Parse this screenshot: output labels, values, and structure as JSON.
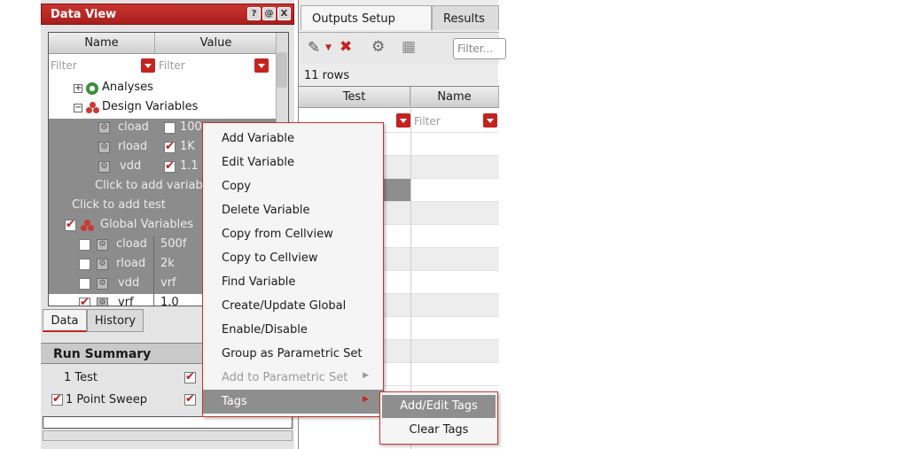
{
  "data_view": {
    "title": "Data View",
    "title_buttons": [
      "?",
      "@",
      "X"
    ],
    "columns": {
      "name": "Name",
      "value": "Value"
    },
    "filter_placeholder": "Filter",
    "tree": {
      "analyses": "Analyses",
      "design_variables": "Design Variables",
      "design_vars": [
        {
          "name": "cload",
          "value": "100"
        },
        {
          "name": "rload",
          "value": "1K"
        },
        {
          "name": "vdd",
          "value": "1.1"
        }
      ],
      "click_add_variable": "Click to add variab",
      "click_add_test": "Click to add test",
      "global_variables": "Global Variables",
      "global_vars": [
        {
          "name": "cload",
          "value": "500f"
        },
        {
          "name": "rload",
          "value": "2k"
        },
        {
          "name": "vdd",
          "value": "vrf"
        },
        {
          "name": "vrf",
          "value": "1.0"
        }
      ]
    },
    "tabs": [
      "Data",
      "History"
    ],
    "run_summary": {
      "title": "Run Summary",
      "items": [
        "1 Test",
        "1 Point Sweep"
      ]
    }
  },
  "outputs": {
    "tabs": [
      "Outputs Setup",
      "Results"
    ],
    "filter_placeholder": "Filter...",
    "rows_label": "11 rows",
    "columns": {
      "test": "Test",
      "name": "Name"
    },
    "filter_cell": "Filter"
  },
  "context_menu": {
    "items": [
      {
        "label": "Add Variable",
        "enabled": true
      },
      {
        "label": "Edit Variable",
        "enabled": true
      },
      {
        "label": "Copy",
        "enabled": true
      },
      {
        "label": "Delete Variable",
        "enabled": true
      },
      {
        "label": "Copy from Cellview",
        "enabled": true
      },
      {
        "label": "Copy to Cellview",
        "enabled": true
      },
      {
        "label": "Find Variable",
        "enabled": true
      },
      {
        "label": "Create/Update Global",
        "enabled": true
      },
      {
        "label": "Enable/Disable",
        "enabled": true
      },
      {
        "label": "Group as Parametric Set",
        "enabled": true
      },
      {
        "label": "Add to Parametric Set",
        "enabled": false
      },
      {
        "label": "Tags",
        "enabled": true
      }
    ],
    "submenu": [
      "Add/Edit Tags",
      "Clear Tags"
    ]
  },
  "colors": {
    "accent_red": "#c42420",
    "selection_gray": "#8e8e8e"
  }
}
